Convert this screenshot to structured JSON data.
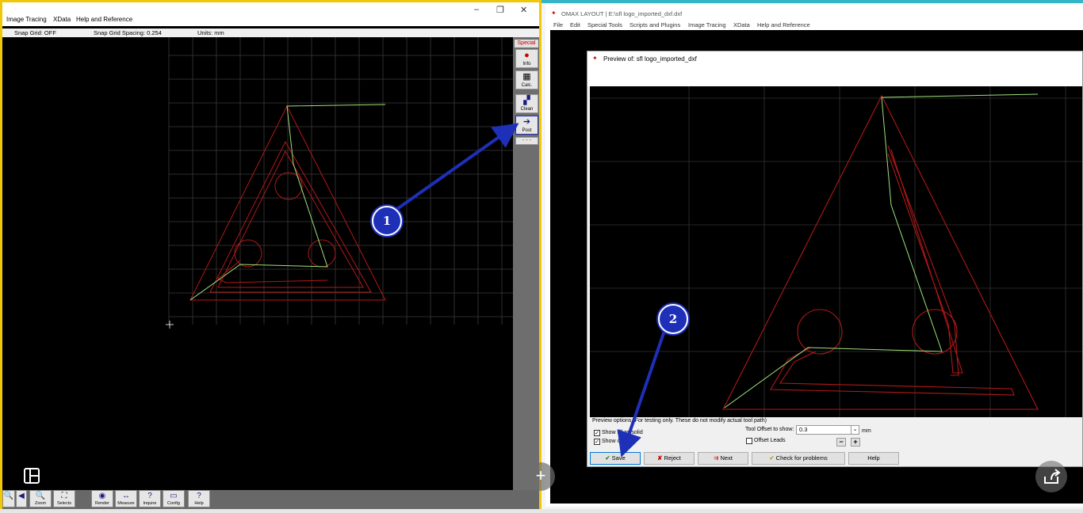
{
  "left_window": {
    "menu": [
      "Image Tracing",
      "XData",
      "Help and Reference"
    ],
    "window_controls": [
      "–",
      "❐",
      "✕"
    ],
    "status": {
      "snap_grid": "Snap Grid: OFF",
      "snap_spacing": "Snap Grid Spacing: 0.254",
      "units": "Units: mm"
    },
    "special_label": "Special",
    "tools": [
      {
        "label": "Info",
        "icon": "info-icon"
      },
      {
        "label": "Calc.",
        "icon": "calculator-icon"
      },
      {
        "label": "Clean",
        "icon": "clean-icon"
      },
      {
        "label": "Post",
        "icon": "post-arrow-icon"
      }
    ],
    "bottom_tools": [
      "Zoom",
      "Selects",
      "Render",
      "Measure",
      "Inquire",
      "Config",
      "Help"
    ]
  },
  "right_window": {
    "title": "OMAX LAYOUT | E:\\sfl logo_imported_dxf.dxf",
    "menu": [
      "File",
      "Edit",
      "Special Tools",
      "Scripts and Plugins",
      "Image Tracing",
      "XData",
      "Help and Reference"
    ],
    "preview": {
      "title": "Preview of: sfl logo_imported_dxf",
      "options_caption": "Preview options (For testing only. These do not modify actual tool path)",
      "show_solid": "Show fill as solid",
      "show_line": "Show outline",
      "tool_offset_label": "Tool Offset to show:",
      "tool_offset_value": "0.3",
      "unit": "mm",
      "offset_leads": "Offset Leads",
      "buttons": {
        "save": "Save",
        "reject": "Reject",
        "next": "Next",
        "check": "Check for problems",
        "help": "Help"
      }
    }
  },
  "callouts": [
    "1",
    "2"
  ],
  "colors": {
    "highlight_border": "#f0c808",
    "annotation_blue": "#1e2fb8",
    "path_red": "#b01818",
    "path_green": "#9ee07a"
  }
}
